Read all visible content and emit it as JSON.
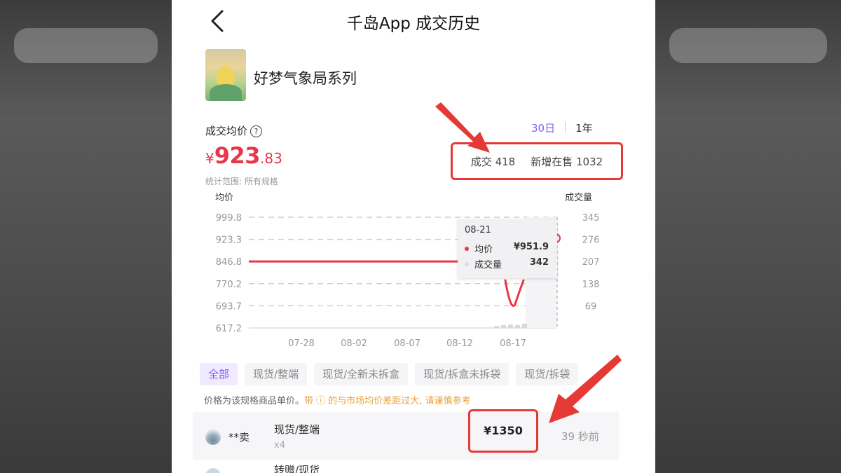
{
  "header": {
    "title": "千岛App 成交历史"
  },
  "product": {
    "series_name": "好梦气象局系列"
  },
  "summary": {
    "avg_label": "成交均价",
    "help_glyph": "?",
    "price_symbol": "¥",
    "price_int": "923",
    "price_dec": ".83",
    "range_note": "统计范围: 所有规格",
    "tabs": [
      "30日",
      "1年"
    ],
    "active_tab": "30日",
    "deals_label": "成交",
    "deals_value": "418",
    "new_listing_label": "新增在售",
    "new_listing_value": "1032"
  },
  "chart_data": {
    "type": "line",
    "ylabel": "均价",
    "y2label": "成交量",
    "y_ticks": [
      "999.8",
      "923.3",
      "846.8",
      "770.2",
      "693.7",
      "617.2"
    ],
    "y2_ticks": [
      "345",
      "276",
      "207",
      "138",
      "69",
      ""
    ],
    "x_ticks": [
      "07-28",
      "08-02",
      "08-07",
      "08-12",
      "08-17"
    ],
    "ylim": [
      617.2,
      999.8
    ],
    "y2lim": [
      0,
      345
    ],
    "series": [
      {
        "values": [
          {
            "x": "07-24",
            "y": 846.8
          },
          {
            "x": "08-14",
            "y": 846.8
          }
        ]
      }
    ],
    "tooltip": {
      "date": "08-21",
      "avg_label": "均价",
      "avg_value": "¥951.9",
      "vol_label": "成交量",
      "vol_value": "342"
    },
    "colors": {
      "avg": "#e8374a",
      "volume": "#d9d9d9",
      "grid": "#e8c4c8"
    }
  },
  "filters": {
    "chips": [
      "全部",
      "现货/整端",
      "现货/全新未拆盒",
      "现货/拆盒未拆袋",
      "现货/拆袋"
    ],
    "active": "全部"
  },
  "notice": {
    "text": "价格为该规格商品单价。",
    "warning": "带 ⓘ 的与市场均价差距过大, 请谨慎参考"
  },
  "records": [
    {
      "seller": "**卖",
      "spec": "现货/整端",
      "qty": "x4",
      "price": "¥1350",
      "time": "39 秒前"
    },
    {
      "spec": "转赠/现货"
    }
  ],
  "colors": {
    "accent": "#8a5cf6",
    "price_red": "#e8374a",
    "highlight_red": "#e53935"
  }
}
